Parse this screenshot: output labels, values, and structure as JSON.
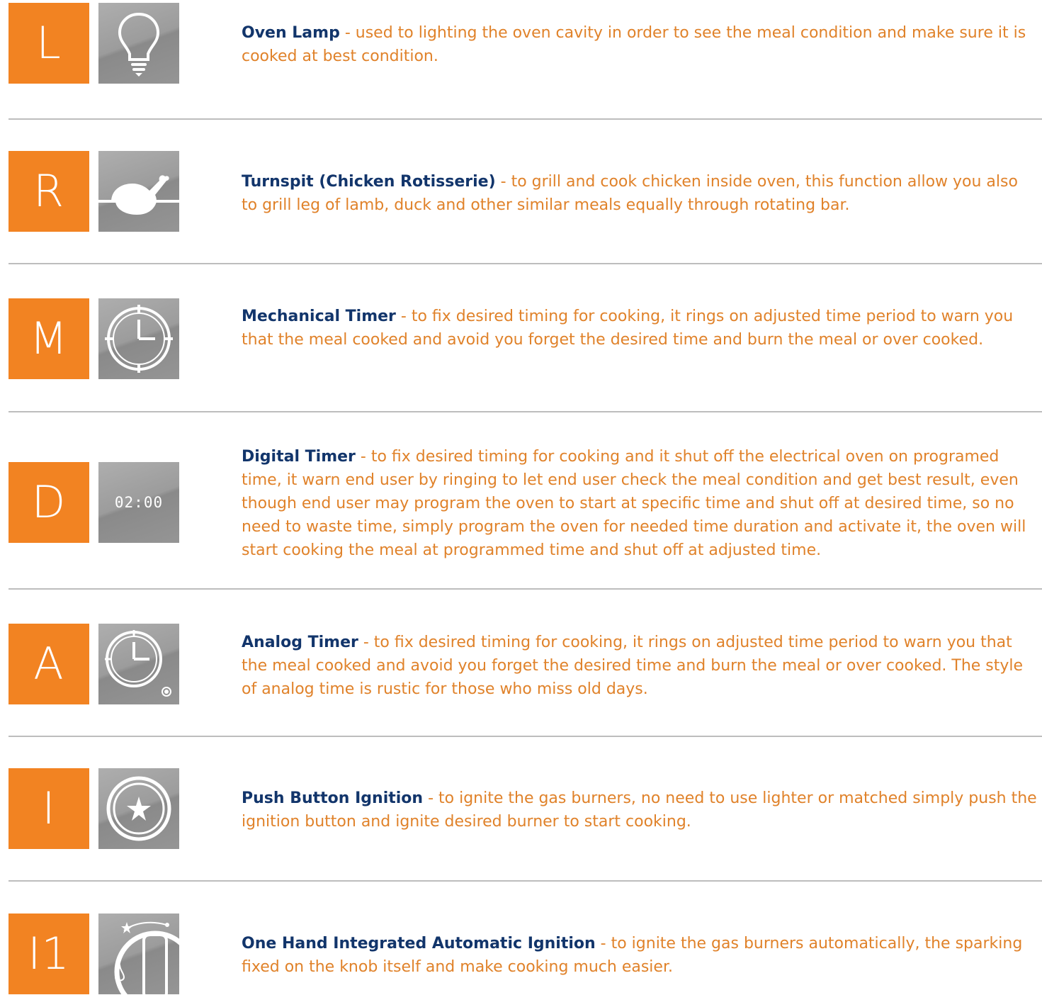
{
  "features": [
    {
      "letter": "L",
      "icon": "lamp-icon",
      "title": "Oven Lamp",
      "text": " - used to lighting the oven cavity in order to see the meal condition and make sure it is cooked at best condition."
    },
    {
      "letter": "R",
      "icon": "chicken-rotisserie-icon",
      "title": "Turnspit (Chicken Rotisserie)",
      "text": " - to grill and cook chicken inside oven, this function allow you also to grill leg of lamb, duck and  other similar meals equally through rotating bar."
    },
    {
      "letter": "M",
      "icon": "mechanical-timer-icon",
      "title": "Mechanical Timer",
      "text": " - to fix desired timing for cooking, it rings on adjusted time period to warn you that the meal cooked and avoid you forget the desired time and burn the meal or over cooked."
    },
    {
      "letter": "D",
      "icon": "digital-timer-icon",
      "icon_text": "02:00",
      "title": "Digital Timer",
      "text": " - to fix desired timing for cooking and it shut off the electrical oven on programed time, it warn end user by ringing to let end user check the meal condition and get best result, even though end user may program the oven to start at specific time and shut off at desired time, so no need to waste time, simply program the oven for needed time duration and activate it, the oven will start cooking the meal at programmed time and shut off at adjusted time."
    },
    {
      "letter": "A",
      "icon": "analog-timer-icon",
      "title": "Analog Timer",
      "text": " - to fix desired timing for cooking, it rings on adjusted time period to warn you that the meal cooked and avoid you forget the desired time and burn the meal or over cooked. The style of analog time is rustic for those who miss old days."
    },
    {
      "letter": "I",
      "icon": "push-button-ignition-icon",
      "title": "Push Button Ignition",
      "text": " -  to ignite the gas burners, no need to use lighter or matched simply push the ignition button and ignite desired burner to start cooking."
    },
    {
      "letter": "I1",
      "icon": "one-hand-ignition-knob-icon",
      "title": "One Hand Integrated Automatic Ignition",
      "text": " - to ignite the gas burners automatically, the sparking fixed on the knob itself and make cooking much easier."
    }
  ],
  "colors": {
    "accent": "#f28322",
    "title": "#12356b",
    "body_text": "#e0822a",
    "icon_bg": "#9c9c9c",
    "separator": "#bdbdbd"
  }
}
